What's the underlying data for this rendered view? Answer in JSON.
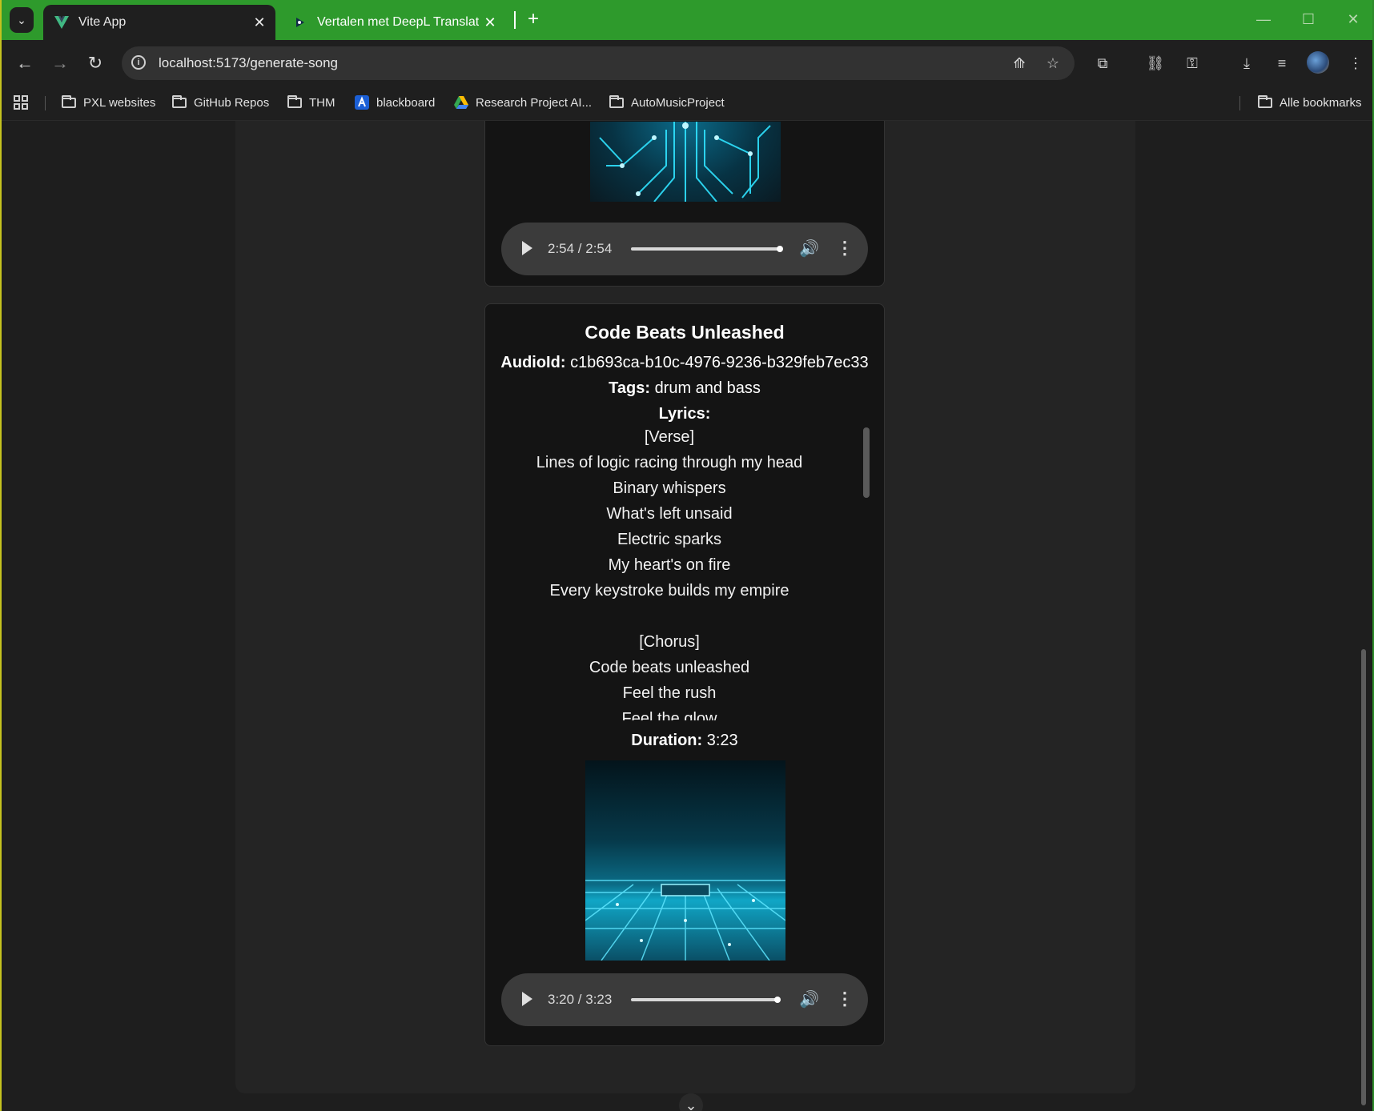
{
  "browser": {
    "tabs": [
      {
        "title": "Vite App",
        "active": true,
        "favicon": "vite-icon"
      },
      {
        "title": "Vertalen met DeepL Translate -",
        "active": false,
        "favicon": "deepl-icon"
      }
    ],
    "url": "localhost:5173/generate-song",
    "bookmarks": [
      {
        "label": "PXL websites",
        "icon": "folder-icon"
      },
      {
        "label": "GitHub Repos",
        "icon": "folder-icon"
      },
      {
        "label": "THM",
        "icon": "folder-icon"
      },
      {
        "label": "blackboard",
        "icon": "blackboard-icon"
      },
      {
        "label": "Research Project AI...",
        "icon": "drive-icon"
      },
      {
        "label": "AutoMusicProject",
        "icon": "folder-icon"
      }
    ],
    "all_bookmarks": "Alle bookmarks"
  },
  "songs": [
    {
      "player": {
        "time": "2:54 / 2:54",
        "progress": 1.0
      }
    },
    {
      "title": "Code Beats Unleashed",
      "audio_id_label": "AudioId:",
      "audio_id": "c1b693ca-b10c-4976-9236-b329feb7ec33",
      "tags_label": "Tags:",
      "tags": "drum and bass",
      "lyrics_label": "Lyrics:",
      "lyrics": [
        "[Verse]",
        "Lines of logic racing through my head",
        "Binary whispers",
        "What's left unsaid",
        "Electric sparks",
        "My heart's on fire",
        "Every keystroke builds my empire",
        "",
        "[Chorus]",
        "Code beats unleashed",
        "Feel the rush",
        "Feel the glow"
      ],
      "duration_label": "Duration:",
      "duration": "3:23",
      "player": {
        "time": "3:20 / 3:23",
        "progress": 0.985
      }
    }
  ]
}
